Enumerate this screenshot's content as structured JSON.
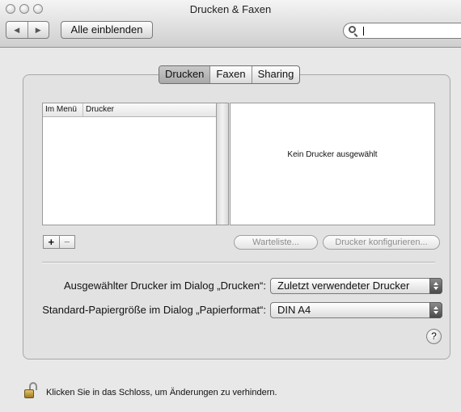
{
  "window": {
    "title": "Drucken & Faxen"
  },
  "toolbar": {
    "show_all_label": "Alle einblenden",
    "back_glyph": "◀",
    "forward_glyph": "▶"
  },
  "search": {
    "value": "",
    "placeholder": ""
  },
  "tabs": [
    {
      "label": "Drucken",
      "selected": true
    },
    {
      "label": "Faxen",
      "selected": false
    },
    {
      "label": "Sharing",
      "selected": false
    }
  ],
  "printer_list": {
    "columns": [
      "Im Menü",
      "Drucker"
    ],
    "rows": []
  },
  "detail": {
    "empty_text": "Kein Drucker ausgewählt"
  },
  "list_buttons": {
    "add": "+",
    "remove": "−"
  },
  "actions": {
    "queue_label": "Warteliste...",
    "configure_label": "Drucker konfigurieren..."
  },
  "settings": {
    "printer_label": "Ausgewählter Drucker im Dialog „Drucken“:",
    "printer_value": "Zuletzt verwendeter Drucker",
    "paper_label": "Standard-Papiergröße im Dialog „Papierformat“:",
    "paper_value": "DIN A4"
  },
  "help": "?",
  "lock": {
    "text": "Klicken Sie in das Schloss, um Änderungen zu verhindern."
  }
}
